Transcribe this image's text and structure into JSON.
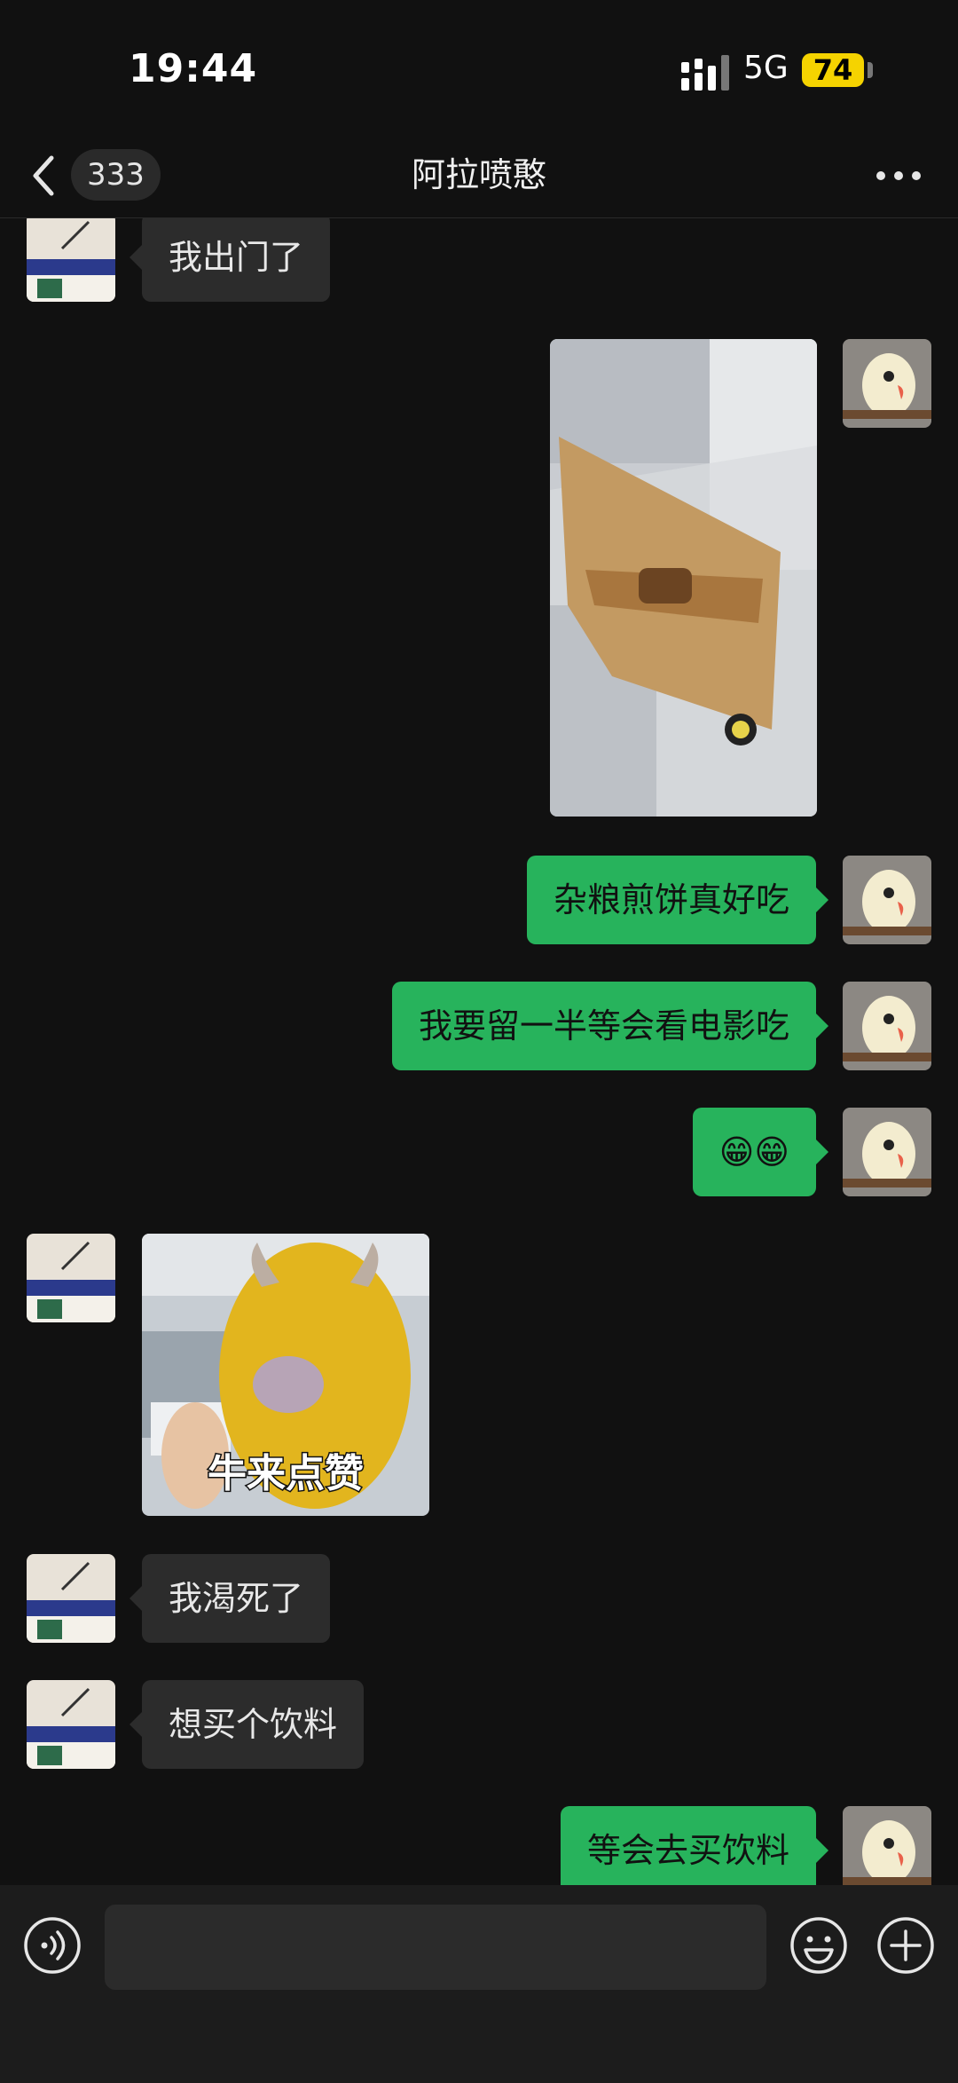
{
  "status": {
    "time": "19:44",
    "network": "5G",
    "battery": "74"
  },
  "nav": {
    "unread_count": "333",
    "title": "阿拉喷憨"
  },
  "messages": [
    {
      "type": "text",
      "side": "in",
      "text": "我出门了"
    },
    {
      "type": "image",
      "side": "out",
      "description": "photo-food-wrap"
    },
    {
      "type": "text",
      "side": "out",
      "text": "杂粮煎饼真好吃"
    },
    {
      "type": "text",
      "side": "out",
      "text": "我要留一半等会看电影吃"
    },
    {
      "type": "text",
      "side": "out",
      "text": "😁😁"
    },
    {
      "type": "sticker",
      "side": "in",
      "caption": "牛来点赞"
    },
    {
      "type": "text",
      "side": "in",
      "text": "我渴死了"
    },
    {
      "type": "text",
      "side": "in",
      "text": "想买个饮料"
    },
    {
      "type": "text",
      "side": "out",
      "text": "等会去买饮料"
    }
  ],
  "input": {
    "value": "",
    "placeholder": ""
  },
  "icons": {
    "back": "chevron-left-icon",
    "more": "more-dots-icon",
    "voice": "voice-icon",
    "emoji": "emoji-icon",
    "plus": "plus-icon"
  },
  "colors": {
    "background": "#111111",
    "outgoing_bubble": "#27b35c",
    "incoming_bubble": "#2c2c2c",
    "battery": "#f5d300"
  }
}
